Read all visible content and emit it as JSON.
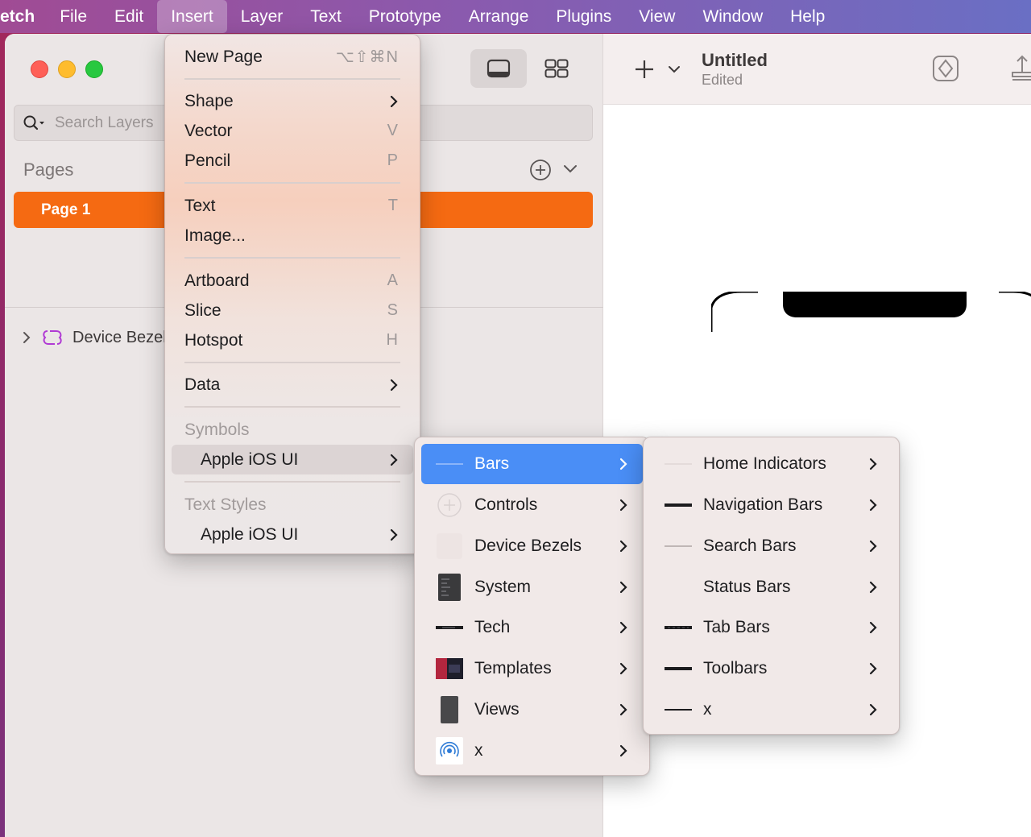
{
  "menubar": {
    "app": "etch",
    "items": [
      "File",
      "Edit",
      "Insert",
      "Layer",
      "Text",
      "Prototype",
      "Arrange",
      "Plugins",
      "View",
      "Window",
      "Help"
    ],
    "active": "Insert"
  },
  "sidebar": {
    "search_placeholder": "Search Layers",
    "pages_label": "Pages",
    "page_name": "Page 1",
    "layer_name": "Device Bezel"
  },
  "document": {
    "title": "Untitled",
    "status": "Edited"
  },
  "insert_menu": {
    "new_page": {
      "label": "New Page",
      "shortcut": "⌥⇧⌘N"
    },
    "shape": {
      "label": "Shape"
    },
    "vector": {
      "label": "Vector",
      "shortcut": "V"
    },
    "pencil": {
      "label": "Pencil",
      "shortcut": "P"
    },
    "text": {
      "label": "Text",
      "shortcut": "T"
    },
    "image": {
      "label": "Image..."
    },
    "artboard": {
      "label": "Artboard",
      "shortcut": "A"
    },
    "slice": {
      "label": "Slice",
      "shortcut": "S"
    },
    "hotspot": {
      "label": "Hotspot",
      "shortcut": "H"
    },
    "data": {
      "label": "Data"
    },
    "symbols_header": "Symbols",
    "symbols_library": "Apple iOS UI",
    "text_styles_header": "Text Styles",
    "text_styles_library": "Apple iOS UI"
  },
  "symbols_submenu": [
    {
      "label": "Bars",
      "icon": "bar-line-icon"
    },
    {
      "label": "Controls",
      "icon": "plus-circle-icon"
    },
    {
      "label": "Device Bezels",
      "icon": "device-bezel-icon"
    },
    {
      "label": "System",
      "icon": "keyboard-panel-icon"
    },
    {
      "label": "Tech",
      "icon": "tech-bar-icon"
    },
    {
      "label": "Templates",
      "icon": "template-thumbnail-icon"
    },
    {
      "label": "Views",
      "icon": "phone-view-icon"
    },
    {
      "label": "x",
      "icon": "airdrop-icon"
    }
  ],
  "bars_submenu": [
    {
      "label": "Home Indicators",
      "icon": "home-indicator-icon"
    },
    {
      "label": "Navigation Bars",
      "icon": "navigation-bar-icon"
    },
    {
      "label": "Search Bars",
      "icon": "search-bar-icon"
    },
    {
      "label": "Status Bars",
      "icon": "status-bar-icon"
    },
    {
      "label": "Tab Bars",
      "icon": "tab-bar-icon"
    },
    {
      "label": "Toolbars",
      "icon": "toolbar-icon"
    },
    {
      "label": "x",
      "icon": "line-icon"
    }
  ],
  "colors": {
    "accent_page": "#f56a12",
    "menu_selection": "#4a8ef6"
  }
}
